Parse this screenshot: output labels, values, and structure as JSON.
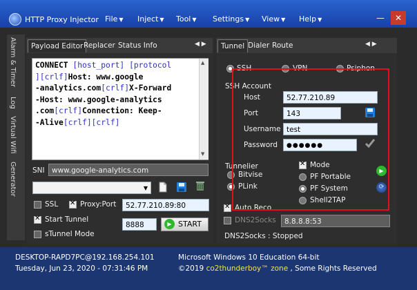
{
  "window": {
    "title": "HTTP Proxy Injector",
    "minimize_icon": "minimize-icon",
    "close_icon": "close-icon"
  },
  "menu": [
    {
      "label": "File"
    },
    {
      "label": "Inject"
    },
    {
      "label": "Tool"
    },
    {
      "label": "Settings"
    },
    {
      "label": "View"
    },
    {
      "label": "Help"
    }
  ],
  "side_tabs": [
    "Alarm & Timer",
    "Log",
    "Virtual Wifi",
    "Generator"
  ],
  "left_tabs": {
    "payload_editor": "Payload Editor",
    "replacer": "Replacer",
    "status_info": "Status Info"
  },
  "payload_lines": [
    [
      {
        "t": "CONNECT "
      },
      {
        "t": "[host_port]",
        "c": "ph"
      },
      {
        "t": " "
      },
      {
        "t": "[protocol",
        "c": "ph"
      }
    ],
    [
      {
        "t": "]",
        "c": "ph"
      },
      {
        "t": "[crlf]",
        "c": "crlf"
      },
      {
        "t": "Host: www.google"
      }
    ],
    [
      {
        "t": "-analytics.com"
      },
      {
        "t": "[crlf]",
        "c": "crlf"
      },
      {
        "t": "X-Forward"
      }
    ],
    [
      {
        "t": "-Host: www.google-analytics"
      }
    ],
    [
      {
        "t": ".com"
      },
      {
        "t": "[crlf]",
        "c": "crlf"
      },
      {
        "t": "Connection: Keep-"
      }
    ],
    [
      {
        "t": "-Alive"
      },
      {
        "t": "[crlf]",
        "c": "crlf"
      },
      {
        "t": "[crlf]",
        "c": "crlf"
      }
    ]
  ],
  "sni": {
    "label": "SNI",
    "value": "www.google-analytics.com"
  },
  "left_controls": {
    "ssl_label": "SSL",
    "ssl_checked": false,
    "proxy_port_label": "Proxy:Port",
    "proxy_port_checked": true,
    "proxy_port_value": "52.77.210.89:80",
    "start_tunnel_label": "Start Tunnel",
    "start_tunnel_checked": true,
    "stunnel_label": "sTunnel Mode",
    "stunnel_checked": false,
    "local_port": "8888",
    "start_button": "START"
  },
  "right_tabs": {
    "tunnel": "Tunnel",
    "dialer": "Dialer",
    "route": "Route"
  },
  "protocol_options": [
    {
      "label": "SSH",
      "selected": true
    },
    {
      "label": "VPN",
      "selected": false
    },
    {
      "label": "Psiphon",
      "selected": false
    }
  ],
  "ssh_account": {
    "heading": "SSH Account",
    "host_label": "Host",
    "host": "52.77.210.89",
    "port_label": "Port",
    "port": "143",
    "username_label": "Username",
    "username": "test",
    "password_label": "Password",
    "password": "●●●●●●"
  },
  "tunnelier": {
    "heading": "Tunnelier",
    "options": [
      {
        "label": "Bitvise",
        "selected": false
      },
      {
        "label": "PLink",
        "selected": true
      }
    ],
    "mode_label": "Mode",
    "mode_checked": true,
    "mode_options": [
      {
        "label": "PF Portable",
        "selected": false
      },
      {
        "label": "PF System",
        "selected": true
      },
      {
        "label": "Shell2TAP",
        "selected": false
      }
    ]
  },
  "auto_reco": {
    "label": "Auto Reco",
    "checked": true
  },
  "dns2socks": {
    "label": "DNS2Socks",
    "checked": false,
    "value": "8.8.8.8:53",
    "status": "DNS2Socks : Stopped"
  },
  "status_bar": {
    "host_line": "DESKTOP-RAPD7PC@192.168.254.101",
    "datetime": "Tuesday, Jun 23, 2020 - 07:31:46 PM",
    "os": "Microsoft Windows 10 Education 64-bit",
    "copyright_prefix": "©2019 ",
    "copyright_brand": "co2thunderboy™ zone",
    "copyright_suffix": " , Some Rights Reserved"
  },
  "colors": {
    "accent_red": "#e0101e",
    "title_blue": "#2a63d0",
    "status_blue": "#1c3672",
    "start_green": "#2db82d"
  }
}
